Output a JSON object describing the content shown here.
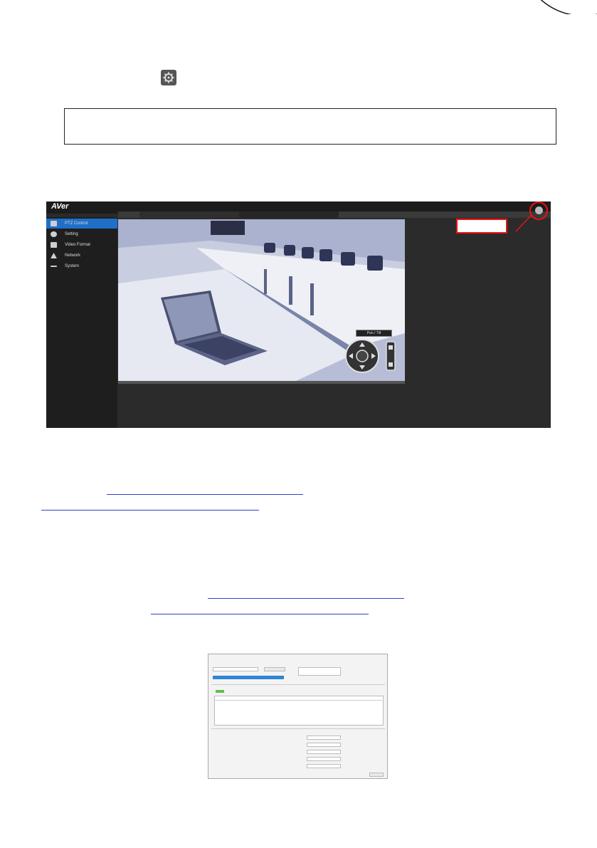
{
  "web_ui": {
    "logo": "AVer",
    "tabs": [
      "",
      ""
    ],
    "sidebar": [
      {
        "label": "PTZ Control",
        "icon": "camera-icon",
        "active": true
      },
      {
        "label": "Setting",
        "icon": "gear-icon",
        "active": false
      },
      {
        "label": "Video Format",
        "icon": "film-icon",
        "active": false
      },
      {
        "label": "Network",
        "icon": "network-icon",
        "active": false
      },
      {
        "label": "System",
        "icon": "system-icon",
        "active": false
      }
    ],
    "ptz_label": "Pan / Tilt",
    "highlight_color": "#e11111",
    "active_color": "#1f6fc8"
  }
}
